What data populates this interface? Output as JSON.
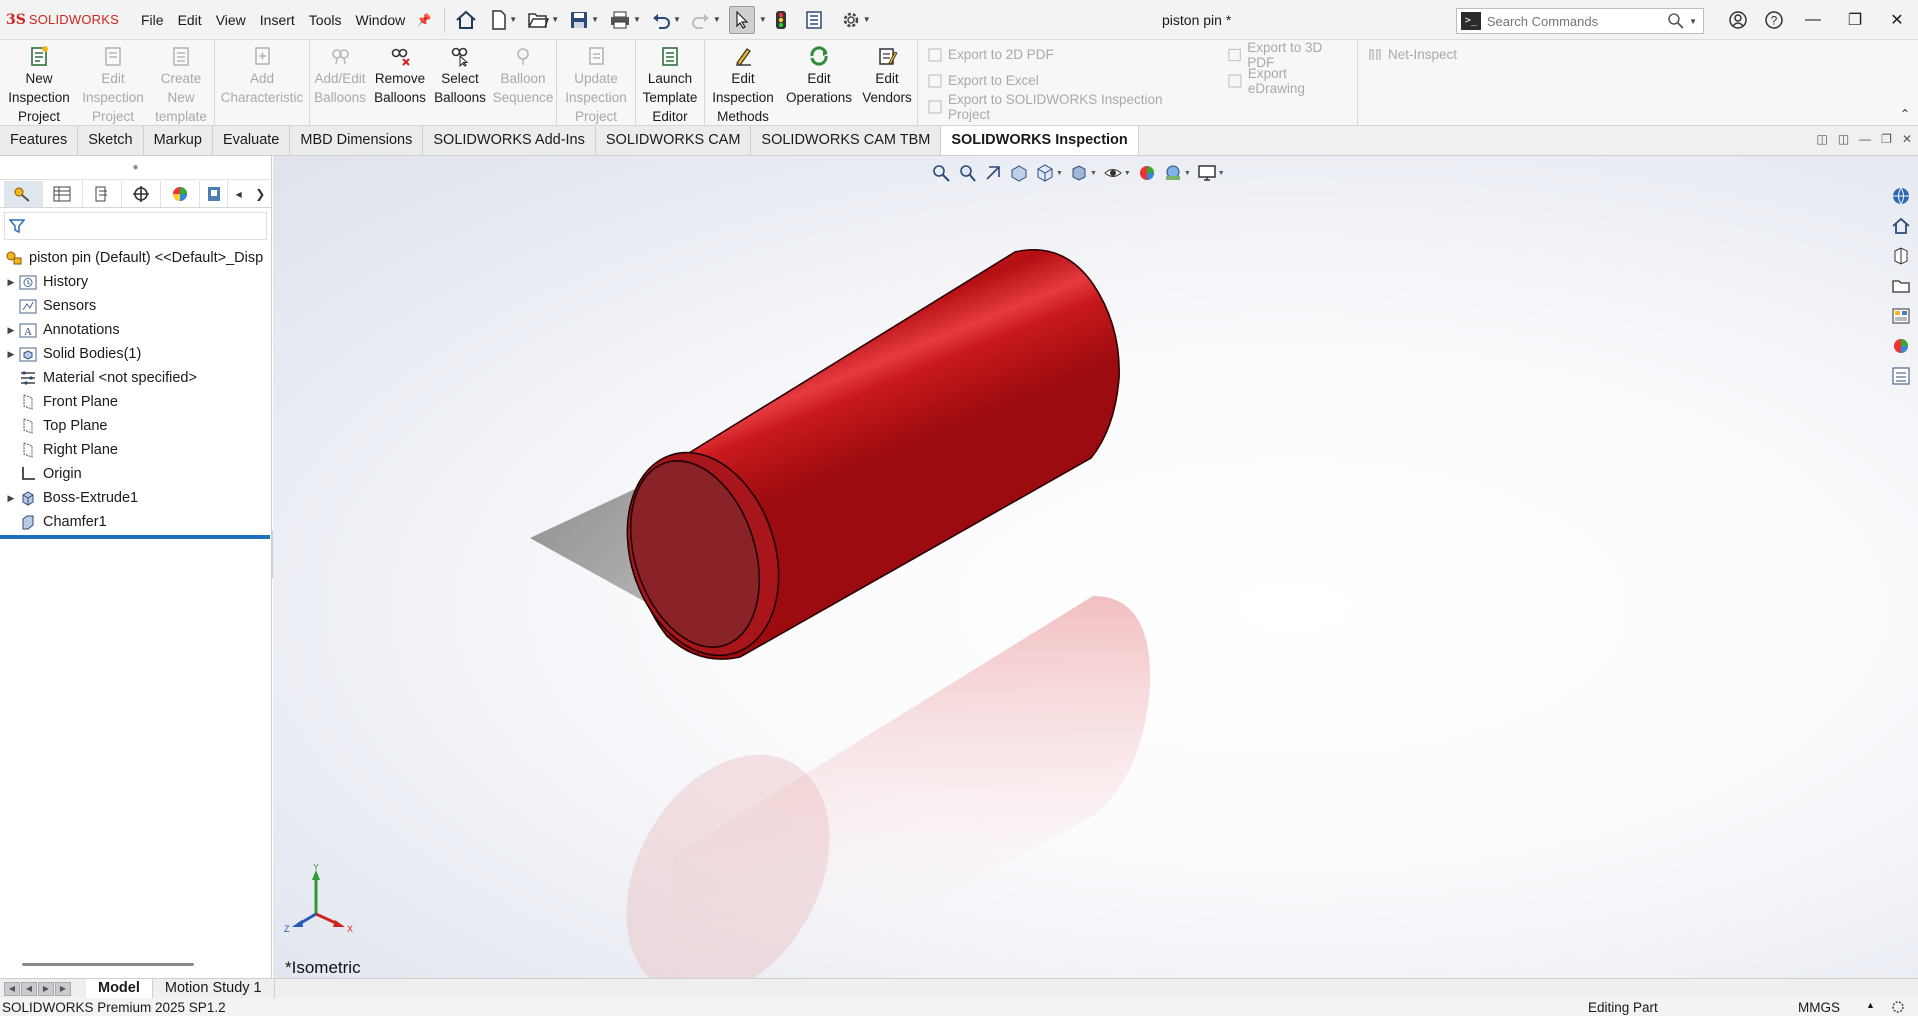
{
  "app": {
    "brand_ds": "3S",
    "brand_name": "SOLIDWORKS",
    "document_title": "piston pin *"
  },
  "menu": [
    "File",
    "Edit",
    "View",
    "Insert",
    "Tools",
    "Window"
  ],
  "search": {
    "placeholder": "Search Commands"
  },
  "ribbon": {
    "inspection_group": [
      {
        "label": "New\nInspection\nProject",
        "enabled": true,
        "icon": "new-inspection-icon"
      },
      {
        "label": "Edit\nInspection\nProject",
        "enabled": false,
        "icon": "edit-inspection-icon"
      },
      {
        "label": "Create\nNew\ntemplate",
        "enabled": false,
        "icon": "create-template-icon"
      }
    ],
    "characteristic_group": [
      {
        "label": "Add\nCharacteristic",
        "enabled": false,
        "icon": "add-characteristic-icon"
      }
    ],
    "balloon_group": [
      {
        "label": "Add/Edit\nBalloons",
        "enabled": false,
        "icon": "add-balloons-icon"
      },
      {
        "label": "Remove\nBalloons",
        "enabled": true,
        "icon": "remove-balloons-icon"
      },
      {
        "label": "Select\nBalloons",
        "enabled": true,
        "icon": "select-balloons-icon"
      },
      {
        "label": "Balloon\nSequence",
        "enabled": false,
        "icon": "balloon-sequence-icon"
      }
    ],
    "update_group": [
      {
        "label": "Update\nInspection\nProject",
        "enabled": false,
        "icon": "update-inspection-icon"
      }
    ],
    "template_group": [
      {
        "label": "Launch\nTemplate\nEditor",
        "enabled": true,
        "icon": "template-editor-icon"
      }
    ],
    "methods_group": [
      {
        "label": "Edit\nInspection\nMethods",
        "enabled": true,
        "icon": "inspection-methods-icon"
      },
      {
        "label": "Edit\nOperations",
        "enabled": true,
        "icon": "operations-icon"
      },
      {
        "label": "Edit\nVendors",
        "enabled": true,
        "icon": "vendors-icon"
      }
    ],
    "export_col1": [
      "Export to 2D PDF",
      "Export to Excel",
      "Export to SOLIDWORKS Inspection Project"
    ],
    "export_col2": [
      "Export to 3D PDF",
      "Export eDrawing"
    ],
    "net_inspect": "Net-Inspect"
  },
  "tabs": [
    {
      "label": "Features",
      "active": false
    },
    {
      "label": "Sketch",
      "active": false
    },
    {
      "label": "Markup",
      "active": false
    },
    {
      "label": "Evaluate",
      "active": false
    },
    {
      "label": "MBD Dimensions",
      "active": false
    },
    {
      "label": "SOLIDWORKS Add-Ins",
      "active": false
    },
    {
      "label": "SOLIDWORKS CAM",
      "active": false
    },
    {
      "label": "SOLIDWORKS CAM TBM",
      "active": false
    },
    {
      "label": "SOLIDWORKS Inspection",
      "active": true
    }
  ],
  "tree": {
    "root": "piston pin (Default) <<Default>_Disp",
    "items": [
      {
        "label": "History",
        "expandable": true,
        "icon": "history-folder-icon"
      },
      {
        "label": "Sensors",
        "expandable": false,
        "icon": "sensors-folder-icon"
      },
      {
        "label": "Annotations",
        "expandable": true,
        "icon": "annotations-folder-icon"
      },
      {
        "label": "Solid Bodies(1)",
        "expandable": true,
        "icon": "solid-bodies-folder-icon"
      },
      {
        "label": "Material <not specified>",
        "expandable": false,
        "icon": "material-icon"
      },
      {
        "label": "Front Plane",
        "expandable": false,
        "icon": "plane-icon"
      },
      {
        "label": "Top Plane",
        "expandable": false,
        "icon": "plane-icon"
      },
      {
        "label": "Right Plane",
        "expandable": false,
        "icon": "plane-icon"
      },
      {
        "label": "Origin",
        "expandable": false,
        "icon": "origin-icon"
      },
      {
        "label": "Boss-Extrude1",
        "expandable": true,
        "icon": "extrude-icon"
      },
      {
        "label": "Chamfer1",
        "expandable": false,
        "icon": "chamfer-icon"
      }
    ]
  },
  "viewport": {
    "view_name": "*Isometric",
    "triad": {
      "y": "Y",
      "z": "Z",
      "x": "X"
    },
    "part_color": "#c8191d"
  },
  "bottom_tabs": [
    {
      "label": "Model",
      "active": true
    },
    {
      "label": "Motion Study 1",
      "active": false
    }
  ],
  "status": {
    "left": "SOLIDWORKS Premium 2025 SP1.2",
    "editing": "Editing Part",
    "units": "MMGS"
  }
}
